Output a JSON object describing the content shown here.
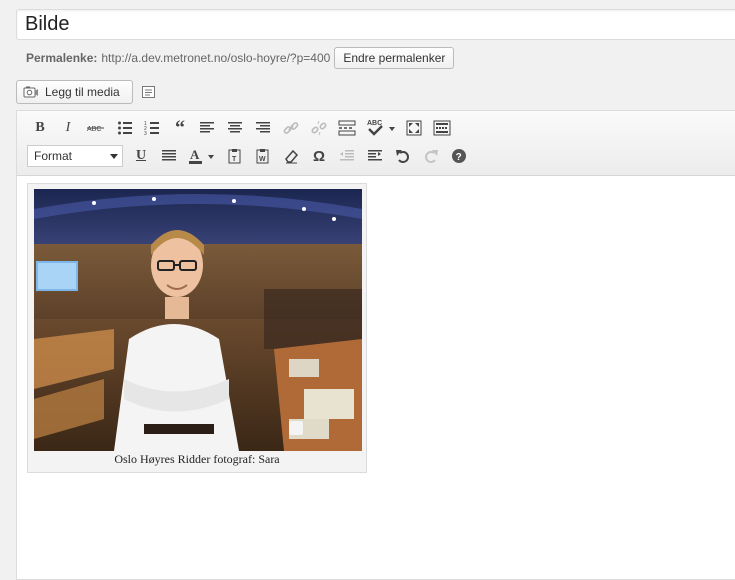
{
  "post": {
    "title": "Bilde"
  },
  "permalink": {
    "label": "Permalenke:",
    "url": "http://a.dev.metronet.no/oslo-hoyre/?p=400",
    "edit_button": "Endre permalenker"
  },
  "media": {
    "add_button": "Legg til media"
  },
  "toolbar": {
    "format_select": "Format"
  },
  "content": {
    "image_caption": "Oslo Høyres Ridder fotograf: Sara"
  }
}
